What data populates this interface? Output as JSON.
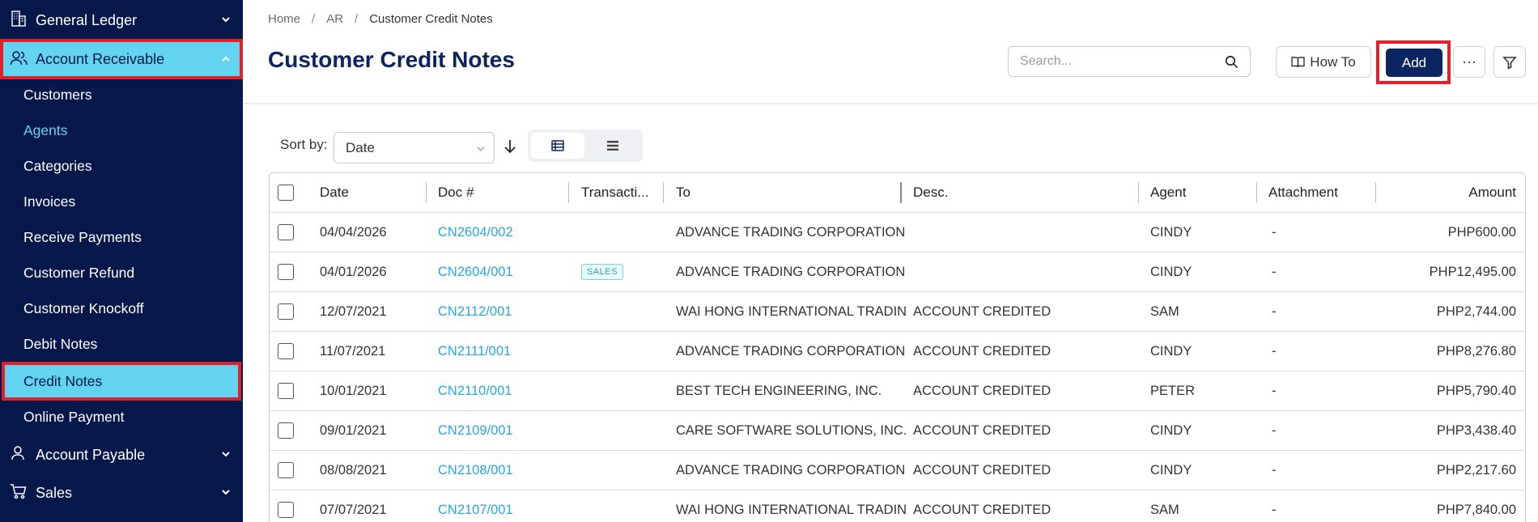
{
  "sidebar": {
    "groups": {
      "general_ledger": "General Ledger",
      "account_receivable": "Account Receivable",
      "account_payable": "Account Payable",
      "sales": "Sales"
    },
    "ar_items": [
      "Customers",
      "Agents",
      "Categories",
      "Invoices",
      "Receive Payments",
      "Customer Refund",
      "Customer Knockoff",
      "Debit Notes",
      "Credit Notes",
      "Online Payment"
    ],
    "active_item": "Credit Notes",
    "colors": {
      "background": "#06174a",
      "active": "#62d4f2",
      "highlight_text": "#63d2f3",
      "annotation_outline": "#e0202a"
    }
  },
  "breadcrumb": {
    "home": "Home",
    "section": "AR",
    "current": "Customer Credit Notes"
  },
  "header": {
    "title": "Customer Credit Notes",
    "search_placeholder": "Search...",
    "howto_label": "How To",
    "add_label": "Add",
    "more_label": "···"
  },
  "sort": {
    "label": "Sort by:",
    "selected": "Date",
    "direction": "descending"
  },
  "table": {
    "columns": [
      "Date",
      "Doc #",
      "Transacti...",
      "To",
      "Desc.",
      "Agent",
      "Attachment",
      "Amount"
    ],
    "rows": [
      {
        "date": "04/04/2026",
        "doc": "CN2604/002",
        "transaction": "",
        "to": "ADVANCE TRADING CORPORATION",
        "desc": "",
        "agent": "CINDY",
        "attachment": "-",
        "amount": "PHP600.00"
      },
      {
        "date": "04/01/2026",
        "doc": "CN2604/001",
        "transaction": "SALES",
        "to": "ADVANCE TRADING CORPORATION",
        "desc": "",
        "agent": "CINDY",
        "attachment": "-",
        "amount": "PHP12,495.00"
      },
      {
        "date": "12/07/2021",
        "doc": "CN2112/001",
        "transaction": "",
        "to": "WAI HONG INTERNATIONAL TRADING",
        "desc": "ACCOUNT CREDITED",
        "agent": "SAM",
        "attachment": "-",
        "amount": "PHP2,744.00"
      },
      {
        "date": "11/07/2021",
        "doc": "CN2111/001",
        "transaction": "",
        "to": "ADVANCE TRADING CORPORATION",
        "desc": "ACCOUNT CREDITED",
        "agent": "CINDY",
        "attachment": "-",
        "amount": "PHP8,276.80"
      },
      {
        "date": "10/01/2021",
        "doc": "CN2110/001",
        "transaction": "",
        "to": "BEST TECH ENGINEERING, INC.",
        "desc": "ACCOUNT CREDITED",
        "agent": "PETER",
        "attachment": "-",
        "amount": "PHP5,790.40"
      },
      {
        "date": "09/01/2021",
        "doc": "CN2109/001",
        "transaction": "",
        "to": "CARE SOFTWARE SOLUTIONS, INC.",
        "desc": "ACCOUNT CREDITED",
        "agent": "CINDY",
        "attachment": "-",
        "amount": "PHP3,438.40"
      },
      {
        "date": "08/08/2021",
        "doc": "CN2108/001",
        "transaction": "",
        "to": "ADVANCE TRADING CORPORATION",
        "desc": "ACCOUNT CREDITED",
        "agent": "CINDY",
        "attachment": "-",
        "amount": "PHP2,217.60"
      },
      {
        "date": "07/07/2021",
        "doc": "CN2107/001",
        "transaction": "",
        "to": "WAI HONG INTERNATIONAL TRADING",
        "desc": "ACCOUNT CREDITED",
        "agent": "SAM",
        "attachment": "-",
        "amount": "PHP7,840.00"
      }
    ]
  },
  "colors": {
    "title": "#0c2461",
    "link": "#27a7e0",
    "primary_button": "#0c2461",
    "badge": "#2aa39d"
  }
}
